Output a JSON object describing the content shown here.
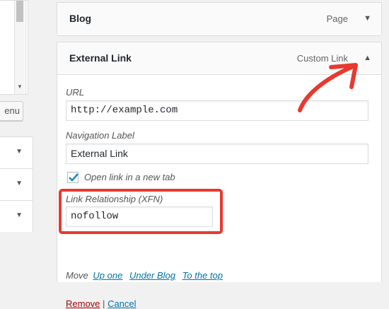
{
  "left_panel": {
    "button_partial_label": "enu",
    "sections": [
      {
        "chevron": "chevron-down-icon"
      },
      {
        "chevron": "chevron-down-icon"
      },
      {
        "chevron": "chevron-down-icon"
      }
    ]
  },
  "blog_item": {
    "title": "Blog",
    "type": "Page"
  },
  "external_item": {
    "title": "External Link",
    "type": "Custom Link",
    "url_label": "URL",
    "url_value": "http://example.com",
    "nav_label_label": "Navigation Label",
    "nav_label_value": "External Link",
    "new_tab_label": "Open link in a new tab",
    "new_tab_checked": true,
    "xfn_label": "Link Relationship (XFN)",
    "xfn_value": "nofollow",
    "move_label": "Move",
    "move_up": "Up one",
    "move_under": "Under Blog",
    "move_top": "To the top",
    "remove_label": "Remove",
    "separator": "|",
    "cancel_label": "Cancel"
  },
  "colors": {
    "annotation_red": "#e8392e",
    "link_blue": "#0073aa",
    "remove_red": "#a00000"
  }
}
